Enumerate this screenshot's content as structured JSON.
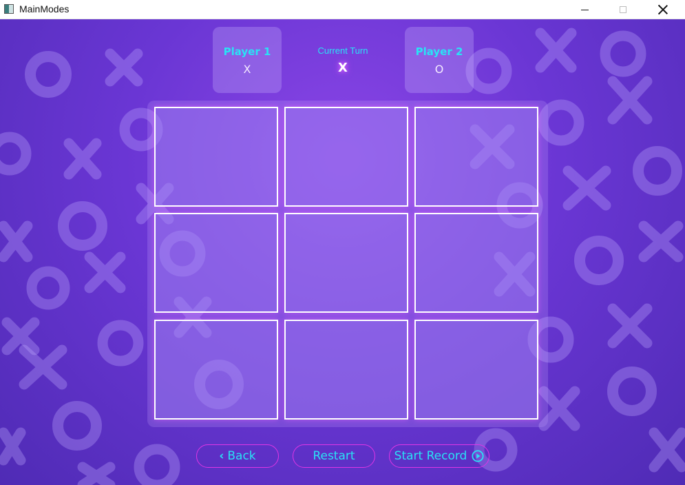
{
  "window": {
    "title": "MainModes"
  },
  "header": {
    "player1": {
      "name": "Player 1",
      "symbol": "X"
    },
    "player2": {
      "name": "Player 2",
      "symbol": "O"
    },
    "turn": {
      "label": "Current Turn",
      "symbol": "X"
    }
  },
  "board": {
    "cells": [
      "",
      "",
      "",
      "",
      "",
      "",
      "",
      "",
      ""
    ]
  },
  "buttons": {
    "back": "Back",
    "restart": "Restart",
    "start_record": "Start Record"
  },
  "icons": {
    "back": "chevron-left-icon",
    "record": "play-circle-icon"
  },
  "colors": {
    "accent_text": "#29e3f5",
    "button_border": "#e135e6",
    "cell_border": "#ffffff"
  }
}
